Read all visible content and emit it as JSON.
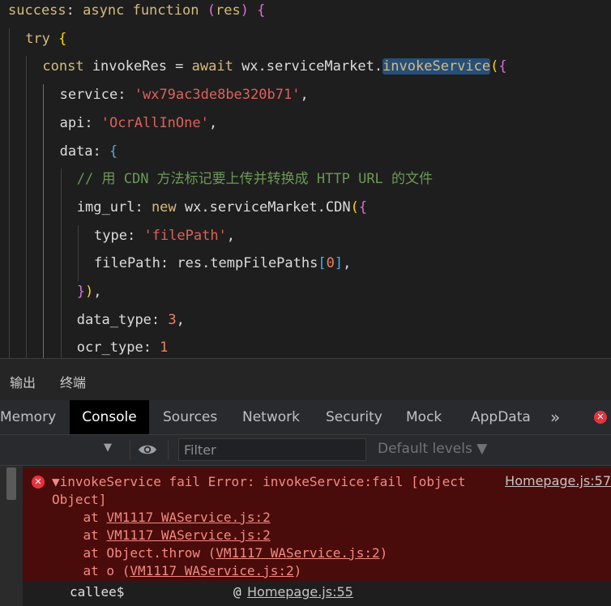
{
  "editor": {
    "lines": [
      [
        {
          "t": "success",
          "c": "kw"
        },
        {
          "t": ": ",
          "c": "pun"
        },
        {
          "t": "async",
          "c": "kw"
        },
        {
          "t": " ",
          "c": "pun"
        },
        {
          "t": "function",
          "c": "kw"
        },
        {
          "t": " ",
          "c": "pun"
        },
        {
          "t": "(",
          "c": "b2"
        },
        {
          "t": "res",
          "c": "kw"
        },
        {
          "t": ")",
          "c": "b2"
        },
        {
          "t": " ",
          "c": "pun"
        },
        {
          "t": "{",
          "c": "b2"
        }
      ],
      [
        {
          "t": "try",
          "c": "kw"
        },
        {
          "t": " ",
          "c": "pun"
        },
        {
          "t": "{",
          "c": "b1"
        }
      ],
      [
        {
          "t": "const",
          "c": "kw"
        },
        {
          "t": " invokeRes = ",
          "c": "ident"
        },
        {
          "t": "await",
          "c": "kw"
        },
        {
          "t": " wx.serviceMarket.",
          "c": "ident"
        },
        {
          "t": "invokeService",
          "c": "kw",
          "hl": true
        },
        {
          "t": "(",
          "c": "b1"
        },
        {
          "t": "{",
          "c": "b2"
        }
      ],
      [
        {
          "t": "service",
          "c": "prop"
        },
        {
          "t": ": ",
          "c": "pun"
        },
        {
          "t": "'wx79ac3de8be320b71'",
          "c": "str"
        },
        {
          "t": ",",
          "c": "pun"
        }
      ],
      [
        {
          "t": "api",
          "c": "prop"
        },
        {
          "t": ": ",
          "c": "pun"
        },
        {
          "t": "'OcrAllInOne'",
          "c": "str"
        },
        {
          "t": ",",
          "c": "pun"
        }
      ],
      [
        {
          "t": "data",
          "c": "prop"
        },
        {
          "t": ": ",
          "c": "pun"
        },
        {
          "t": "{",
          "c": "b3"
        }
      ],
      [
        {
          "t": "// 用 CDN 方法标记要上传并转换成 HTTP URL 的文件",
          "c": "cmt"
        }
      ],
      [
        {
          "t": "img_url",
          "c": "prop"
        },
        {
          "t": ": ",
          "c": "pun"
        },
        {
          "t": "new",
          "c": "kw"
        },
        {
          "t": " wx.serviceMarket.CDN",
          "c": "ident"
        },
        {
          "t": "(",
          "c": "b1"
        },
        {
          "t": "{",
          "c": "b2"
        }
      ],
      [
        {
          "t": "type",
          "c": "prop"
        },
        {
          "t": ": ",
          "c": "pun"
        },
        {
          "t": "'filePath'",
          "c": "str"
        },
        {
          "t": ",",
          "c": "pun"
        }
      ],
      [
        {
          "t": "filePath",
          "c": "prop"
        },
        {
          "t": ": res.tempFilePaths",
          "c": "ident"
        },
        {
          "t": "[",
          "c": "b3"
        },
        {
          "t": "0",
          "c": "num"
        },
        {
          "t": "]",
          "c": "b3"
        },
        {
          "t": ",",
          "c": "pun"
        }
      ],
      [
        {
          "t": "}",
          "c": "b2"
        },
        {
          "t": ")",
          "c": "b1"
        },
        {
          "t": ",",
          "c": "pun"
        }
      ],
      [
        {
          "t": "data_type",
          "c": "prop"
        },
        {
          "t": ": ",
          "c": "pun"
        },
        {
          "t": "3",
          "c": "num"
        },
        {
          "t": ",",
          "c": "pun"
        }
      ],
      [
        {
          "t": "ocr_type",
          "c": "prop"
        },
        {
          "t": ": ",
          "c": "pun"
        },
        {
          "t": "1",
          "c": "num"
        }
      ]
    ],
    "indents": [
      0,
      1,
      2,
      3,
      3,
      3,
      4,
      4,
      5,
      5,
      4,
      4,
      4
    ]
  },
  "panel_tabs": {
    "output_label": "输出",
    "terminal_label": "终端"
  },
  "devtools": {
    "tabs": {
      "memory": "Memory",
      "console": "Console",
      "sources": "Sources",
      "network": "Network",
      "security": "Security",
      "mock": "Mock",
      "appdata": "AppData",
      "more": "»"
    },
    "error_badge": "✕",
    "filter_placeholder": "Filter",
    "levels_label": "Default levels ▼",
    "context_caret": "▼",
    "eye_icon_glyph": "◉"
  },
  "console": {
    "error": {
      "line1": "▼invokeService fail Error: invokeService:fail [object",
      "line2": "Object]",
      "source_link": "Homepage.js:57",
      "stack": [
        {
          "prefix": "    at ",
          "fn": "",
          "link": "VM1117 WAService.js:2",
          "suffix": ""
        },
        {
          "prefix": "    at ",
          "fn": "",
          "link": "VM1117 WAService.js:2",
          "suffix": ""
        },
        {
          "prefix": "    at ",
          "fn": "Object.throw (",
          "link": "VM1117 WAService.js:2",
          "suffix": ")"
        },
        {
          "prefix": "    at ",
          "fn": "o (",
          "link": "VM1117 WAService.js:2",
          "suffix": ")"
        }
      ]
    },
    "callee": {
      "name": "callee$",
      "at": "@",
      "link": "Homepage.js:55"
    }
  },
  "colors": {
    "error_bg": "#4a0b0b",
    "error_text": "#f28b82",
    "active_tab_bg": "#000000"
  }
}
